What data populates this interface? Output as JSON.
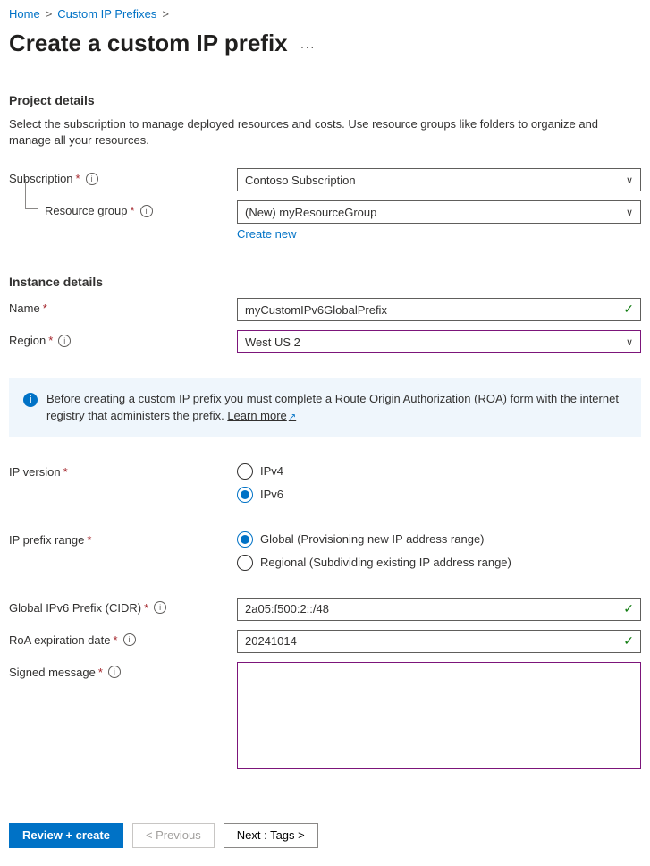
{
  "breadcrumb": {
    "home": "Home",
    "prefixes": "Custom IP Prefixes"
  },
  "title": "Create a custom IP prefix",
  "project": {
    "heading": "Project details",
    "desc": "Select the subscription to manage deployed resources and costs. Use resource groups like folders to organize and manage all your resources.",
    "subscription_label": "Subscription",
    "subscription_value": "Contoso Subscription",
    "rg_label": "Resource group",
    "rg_value": "(New) myResourceGroup",
    "create_new": "Create new"
  },
  "instance": {
    "heading": "Instance details",
    "name_label": "Name",
    "name_value": "myCustomIPv6GlobalPrefix",
    "region_label": "Region",
    "region_value": "West US 2"
  },
  "info": {
    "text": "Before creating a custom IP prefix you must complete a Route Origin Authorization (ROA) form with the internet registry that administers the prefix. ",
    "learn": "Learn more"
  },
  "ip": {
    "version_label": "IP version",
    "v4": "IPv4",
    "v6": "IPv6",
    "range_label": "IP prefix range",
    "range_global": "Global (Provisioning new IP address range)",
    "range_regional": "Regional (Subdividing existing IP address range)",
    "cidr_label": "Global IPv6 Prefix (CIDR)",
    "cidr_value": "2a05:f500:2::/48",
    "roa_label": "RoA expiration date",
    "roa_value": "20241014",
    "signed_label": "Signed message"
  },
  "footer": {
    "review": "Review + create",
    "previous": "< Previous",
    "next": "Next : Tags >"
  }
}
